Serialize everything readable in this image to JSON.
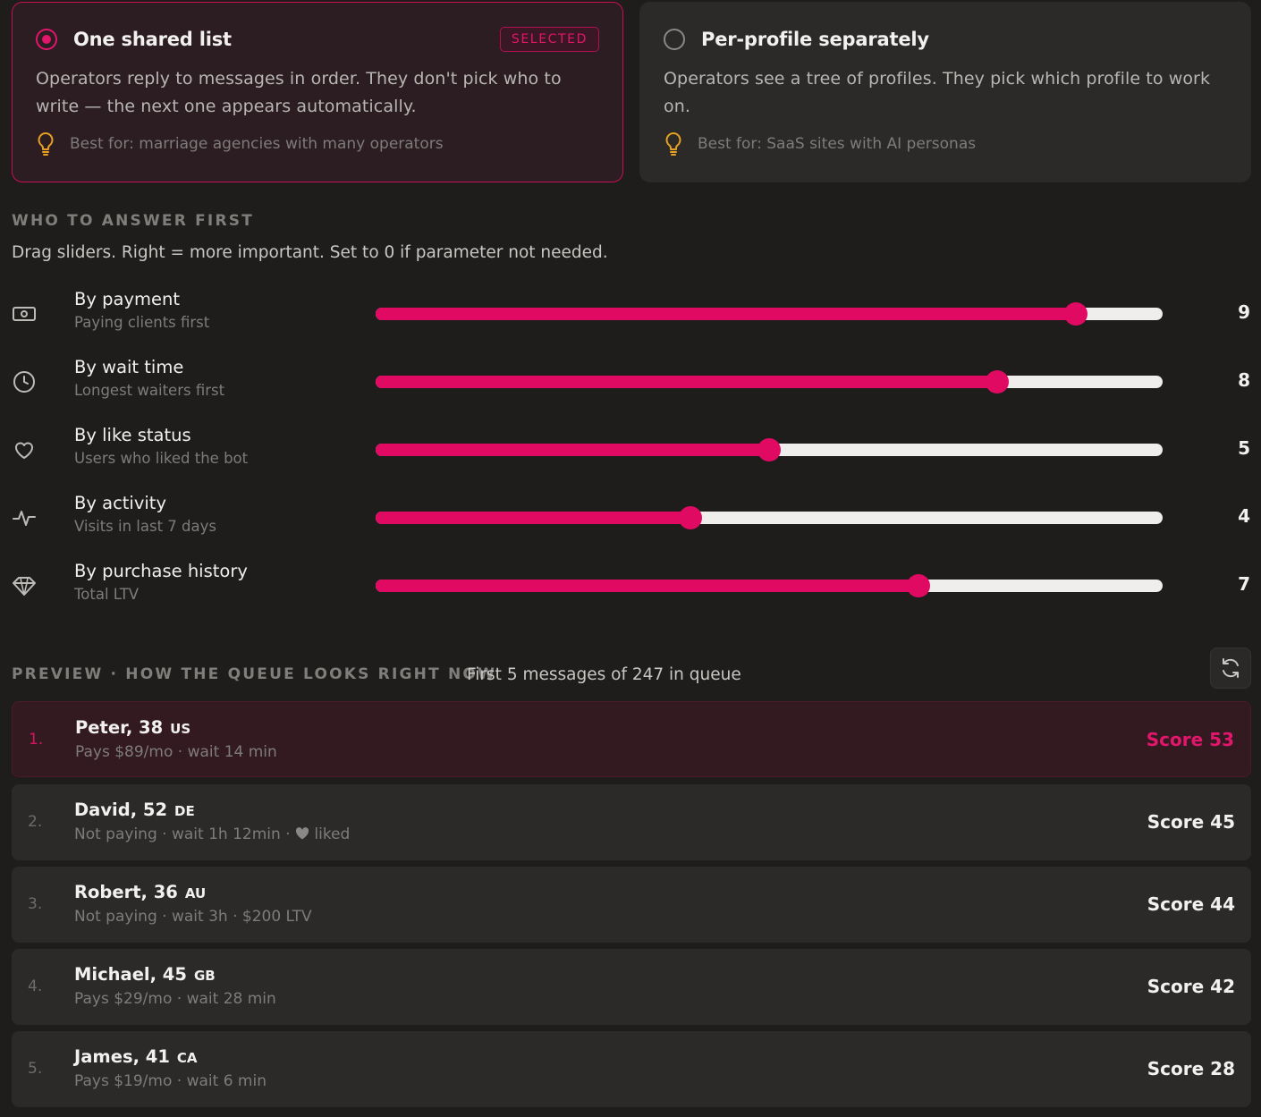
{
  "modes": [
    {
      "title": "One shared list",
      "badge": "SELECTED",
      "description": "Operators reply to messages in order. They don't pick who to write — the next one appears automatically.",
      "best_for": "Best for: marriage agencies with many operators",
      "selected": true
    },
    {
      "title": "Per-profile separately",
      "description": "Operators see a tree of profiles. They pick which profile to work on.",
      "best_for": "Best for: SaaS sites with AI personas",
      "selected": false
    }
  ],
  "priority": {
    "heading": "WHO TO ANSWER FIRST",
    "hint": "Drag sliders. Right = more important. Set to 0 if parameter not needed.",
    "sliders": [
      {
        "title": "By payment",
        "subtitle": "Paying clients first",
        "value": "9",
        "icon": "money-icon",
        "fill_fraction": 0.89
      },
      {
        "title": "By wait time",
        "subtitle": "Longest waiters first",
        "value": "8",
        "icon": "clock-icon",
        "fill_fraction": 0.79
      },
      {
        "title": "By like status",
        "subtitle": "Users who liked the bot",
        "value": "5",
        "icon": "heart-icon",
        "fill_fraction": 0.5
      },
      {
        "title": "By activity",
        "subtitle": "Visits in last 7 days",
        "value": "4",
        "icon": "activity-icon",
        "fill_fraction": 0.4
      },
      {
        "title": "By purchase history",
        "subtitle": "Total LTV",
        "value": "7",
        "icon": "diamond-icon",
        "fill_fraction": 0.69
      }
    ]
  },
  "preview": {
    "heading": "PREVIEW · HOW THE QUEUE LOOKS RIGHT NOW",
    "subheading": "First 5 messages of 247 in queue",
    "queue": [
      {
        "rank": "1.",
        "name": "Peter, 38",
        "country": "US",
        "details": "Pays $89/mo · wait 14 min",
        "score": "Score 53"
      },
      {
        "rank": "2.",
        "name": "David, 52",
        "country": "DE",
        "details_a": "Not paying · wait 1h 12min · ",
        "details_b": " liked",
        "score": "Score 45"
      },
      {
        "rank": "3.",
        "name": "Robert, 36",
        "country": "AU",
        "details": "Not paying · wait 3h · $200 LTV",
        "score": "Score 44"
      },
      {
        "rank": "4.",
        "name": "Michael, 45",
        "country": "GB",
        "details": "Pays $29/mo · wait 28 min",
        "score": "Score 42"
      },
      {
        "rank": "5.",
        "name": "James, 41",
        "country": "CA",
        "details": "Pays $19/mo · wait 6 min",
        "score": "Score 28"
      }
    ]
  },
  "colors": {
    "accent": "#e00a63",
    "background": "#1e1d1c",
    "card": "#2b2a29",
    "bulb": "#e8a020"
  }
}
